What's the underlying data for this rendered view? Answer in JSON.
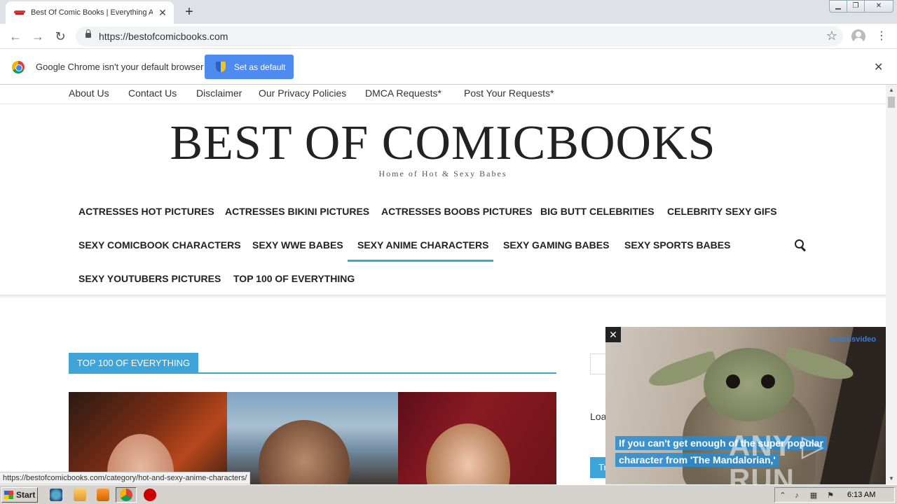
{
  "browser": {
    "tab_title": "Best Of Comic Books | Everything Ab",
    "tab_close": "✕",
    "new_tab": "+",
    "window_controls": {
      "minimize": "▁",
      "maximize": "❐",
      "close": "✕"
    },
    "nav": {
      "back": "←",
      "forward": "→",
      "reload": "↻"
    },
    "url": "https://bestofcomicbooks.com",
    "star": "☆",
    "menu": "⋮",
    "status_url": "https://bestofcomicbooks.com/category/hot-and-sexy-anime-characters/"
  },
  "infobar": {
    "message": "Google Chrome isn't your default browser",
    "button": "Set as default",
    "close": "✕"
  },
  "site": {
    "top_menu": [
      "About Us",
      "Contact Us",
      "Disclaimer",
      "Our Privacy Policies",
      "DMCA Requests*",
      "Post Your Requests*"
    ],
    "logo": "BEST OF COMICBOOKS",
    "tagline": "Home of Hot & Sexy Babes",
    "main_nav": [
      "ACTRESSES HOT PICTURES",
      "ACTRESSES BIKINI PICTURES",
      "ACTRESSES BOOBS PICTURES",
      "BIG BUTT CELEBRITIES",
      "CELEBRITY SEXY GIFS",
      "SEXY COMICBOOK CHARACTERS",
      "SEXY WWE BABES",
      "SEXY ANIME CHARACTERS",
      "SEXY GAMING BABES",
      "SEXY SPORTS BABES",
      "SEXY YOUTUBERS PICTURES",
      "TOP 100 OF EVERYTHING"
    ],
    "active_nav": "SEXY ANIME CHARACTERS",
    "section_title": "TOP 100 OF EVERYTHING",
    "sidebar_loading": "Loa",
    "sidebar_button": "Tr"
  },
  "video_ad": {
    "close": "✕",
    "brand": "avantisvideo",
    "caption_line1": "If you can't get enough of the super popular",
    "caption_line2": "character from 'The Mandalorian,'",
    "watermark": "ANY ▷ RUN"
  },
  "taskbar": {
    "start": "Start",
    "clock": "6:13 AM"
  },
  "colors": {
    "accent": "#3fa5d9",
    "chrome_button": "#4d8bf0"
  }
}
